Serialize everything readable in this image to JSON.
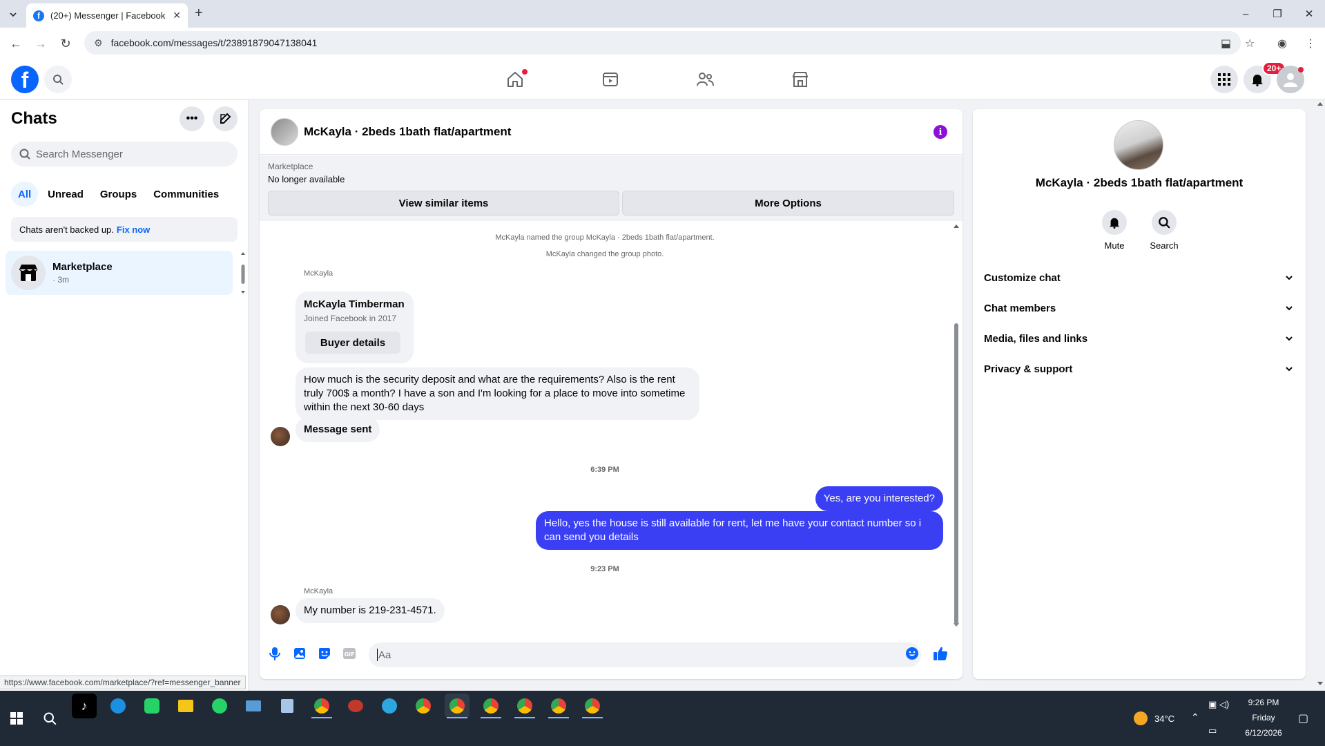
{
  "browser": {
    "tab_title": "(20+) Messenger | Facebook",
    "url": "facebook.com/messages/t/23891879047138041",
    "status_url": "https://www.facebook.com/marketplace/?ref=messenger_banner"
  },
  "fbnav": {
    "notification_badge": "20+"
  },
  "sidebar": {
    "title": "Chats",
    "search_placeholder": "Search Messenger",
    "filters": [
      "All",
      "Unread",
      "Groups",
      "Communities"
    ],
    "backup_text": "Chats aren't backed up.",
    "backup_link": "Fix now",
    "chats": [
      {
        "name": "Marketplace",
        "time": "· 3m"
      }
    ]
  },
  "conversation": {
    "title": "McKayla · 2beds 1bath flat/apartment",
    "banner": {
      "label": "Marketplace",
      "status": "No longer available",
      "btn_similar": "View similar items",
      "btn_more": "More Options"
    },
    "system_1": "McKayla named the group McKayla · 2beds 1bath flat/apartment.",
    "system_2": "McKayla changed the group photo.",
    "sender_1": "McKayla",
    "card_name": "McKayla Timberman",
    "card_sub": "Joined Facebook in 2017",
    "card_btn": "Buyer details",
    "msg_1_line1": "How much is the security deposit and what are the requirements? Also is the rent",
    "msg_1_line2": "truly 700$ a month? I have a son and I'm looking for a place to move into sometime",
    "msg_1_line3": "within the next 30-60 days",
    "msg_2": "Message sent",
    "time_1": "6:39 PM",
    "out_1": "Yes, are you interested?",
    "out_2_line1": "Hello, yes the house is still available for rent, let me have your contact number so i",
    "out_2_line2": "can send you details",
    "time_2": "9:23 PM",
    "sender_2": "McKayla",
    "msg_3": "My number is 219-231-4571.",
    "composer_placeholder": "Aa"
  },
  "details": {
    "name": "McKayla · 2beds 1bath flat/apartment",
    "mute_label": "Mute",
    "search_label": "Search",
    "sections": [
      "Customize chat",
      "Chat members",
      "Media, files and links",
      "Privacy & support"
    ]
  },
  "taskbar": {
    "temperature": "34°C",
    "time": "9:26 PM",
    "day": "Friday",
    "date": "6/12/2026"
  },
  "colors": {
    "fb_blue": "#0866ff",
    "outgoing_bubble": "#3a3ff4",
    "info_purple": "#8b10d9",
    "badge_red": "#e41e3f"
  },
  "icons": [
    "search-icon",
    "home-icon",
    "video-icon",
    "friends-icon",
    "marketplace-icon",
    "apps-grid-icon",
    "bell-icon",
    "profile-icon",
    "more-icon",
    "compose-icon",
    "info-icon",
    "mic-icon",
    "image-icon",
    "sticker-icon",
    "gif-icon",
    "emoji-icon",
    "like-icon",
    "chevron-down-icon"
  ]
}
